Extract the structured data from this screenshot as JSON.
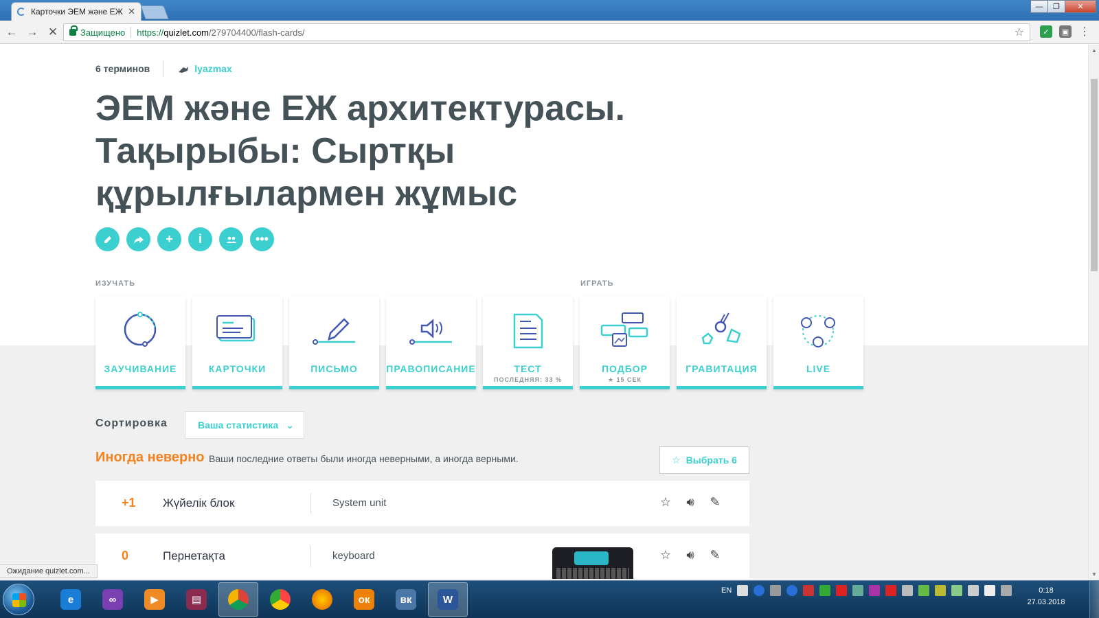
{
  "browser": {
    "tab_title": "Карточки ЭЕМ және ЕЖ",
    "secure_label": "Защищено",
    "url_proto": "https://",
    "url_host": "quizlet.com",
    "url_path": "/279704400/flash-cards/",
    "status_text": "Ожидание quizlet.com..."
  },
  "set": {
    "term_count": "6 терминов",
    "author": "lyazmax",
    "title": "ЭЕМ және ЕЖ архитектурасы. Тақырыбы: Сыртқы құрылғылармен жұмыс"
  },
  "sections": {
    "study": "ИЗУЧАТЬ",
    "play": "ИГРАТЬ"
  },
  "modes": [
    {
      "label": "ЗАУЧИВАНИЕ",
      "sub": "",
      "icon": "learn-icon"
    },
    {
      "label": "КАРТОЧКИ",
      "sub": "",
      "icon": "flashcards-icon"
    },
    {
      "label": "ПИСЬМО",
      "sub": "",
      "icon": "write-icon"
    },
    {
      "label": "ПРАВОПИСАНИЕ",
      "sub": "",
      "icon": "spell-icon"
    },
    {
      "label": "ТЕСТ",
      "sub": "ПОСЛЕДНЯЯ: 33 %",
      "icon": "test-icon"
    },
    {
      "label": "ПОДБОР",
      "sub": "★ 15 СЕК",
      "icon": "match-icon"
    },
    {
      "label": "ГРАВИТАЦИЯ",
      "sub": "",
      "icon": "gravity-icon"
    },
    {
      "label": "LIVE",
      "sub": "",
      "icon": "live-icon"
    }
  ],
  "sort": {
    "label": "Сортировка",
    "value": "Ваша статистика"
  },
  "group": {
    "title": "Иногда неверно",
    "description": "Ваши последние ответы были иногда неверными, а иногда верными.",
    "select_label": "Выбрать 6"
  },
  "cards": [
    {
      "score": "+1",
      "term": "Жүйелік блок",
      "definition": "System unit"
    },
    {
      "score": "0",
      "term": "Пернетақта",
      "definition": "keyboard"
    }
  ],
  "taskbar": {
    "lang": "EN",
    "time": "0:18",
    "date": "27.03.2018"
  },
  "colors": {
    "accent": "#3ccfcf",
    "warning": "#f5821f",
    "title": "#455358"
  }
}
